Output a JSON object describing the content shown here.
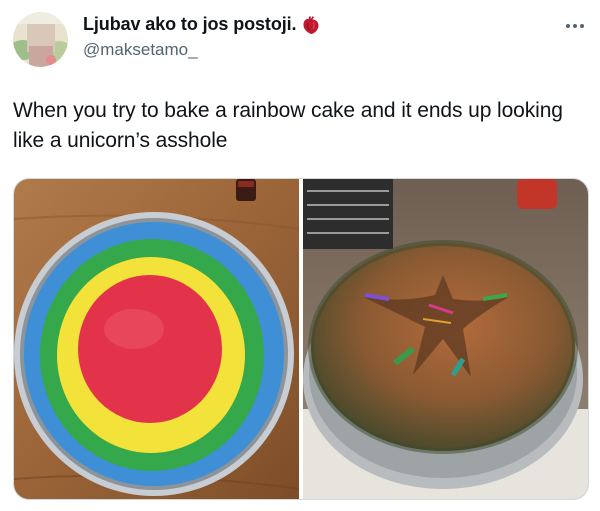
{
  "tweet": {
    "display_name": "Ljubav ako to jos postoji.",
    "handle": "@maksetamo_",
    "text": "When you try to bake a rainbow cake and it ends up looking like a unicorn’s asshole"
  },
  "icons": {
    "name_emoji": "anatomical-heart-icon",
    "more": "more-dots-icon"
  },
  "colors": {
    "text_primary": "#0f1419",
    "text_secondary": "#536471",
    "media_border": "#cfd9de"
  }
}
